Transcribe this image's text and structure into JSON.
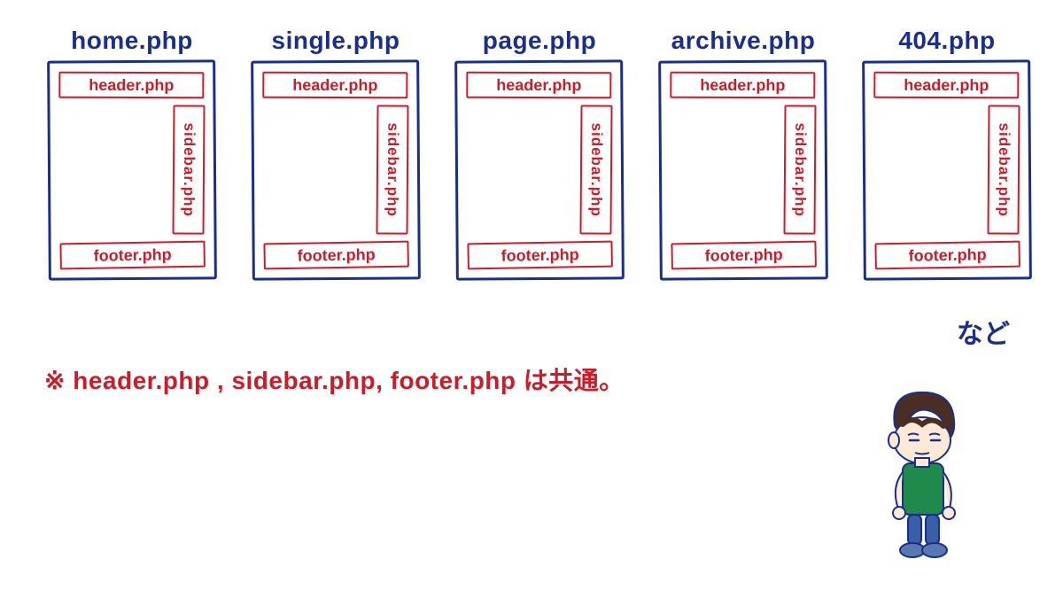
{
  "templates": [
    {
      "title": "home.php",
      "header": "header.php",
      "sidebar": "sidebar.php",
      "footer": "footer.php"
    },
    {
      "title": "single.php",
      "header": "header.php",
      "sidebar": "sidebar.php",
      "footer": "footer.php"
    },
    {
      "title": "page.php",
      "header": "header.php",
      "sidebar": "sidebar.php",
      "footer": "footer.php"
    },
    {
      "title": "archive.php",
      "header": "header.php",
      "sidebar": "sidebar.php",
      "footer": "footer.php"
    },
    {
      "title": "404.php",
      "header": "header.php",
      "sidebar": "sidebar.php",
      "footer": "footer.php"
    }
  ],
  "etc_label": "など",
  "note_text": "※ header.php , sidebar.php, footer.php は共通。"
}
